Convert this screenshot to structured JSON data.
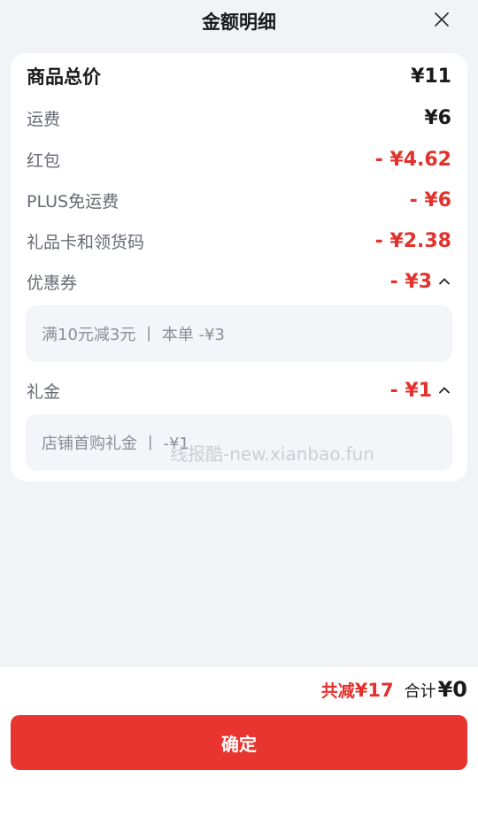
{
  "header": {
    "title": "金额明细",
    "close_icon": "close-icon"
  },
  "rows": [
    {
      "label": "商品总价",
      "value": "¥11"
    },
    {
      "label": "运费",
      "value": "¥6"
    },
    {
      "label": "红包",
      "value": "- ¥4.62"
    },
    {
      "label": "PLUS免运费",
      "value": "- ¥6"
    },
    {
      "label": "礼品卡和领货码",
      "value": "- ¥2.38"
    },
    {
      "label": "优惠券",
      "value": "- ¥3"
    },
    {
      "label": "礼金",
      "value": "- ¥1"
    }
  ],
  "coupon_detail": "满10元减3元 丨 本单 -¥3",
  "gift_detail": "店铺首购礼金 丨 -¥1",
  "watermark": "线报酷-new.xianbao.fun",
  "footer": {
    "saved_label": "共减",
    "saved_amount": "¥17",
    "total_label": "合计",
    "total_amount": "¥0",
    "confirm_label": "确定"
  },
  "colors": {
    "accent_red": "#e2322d",
    "button_red": "#e8352f",
    "background": "#f2f3f7"
  }
}
